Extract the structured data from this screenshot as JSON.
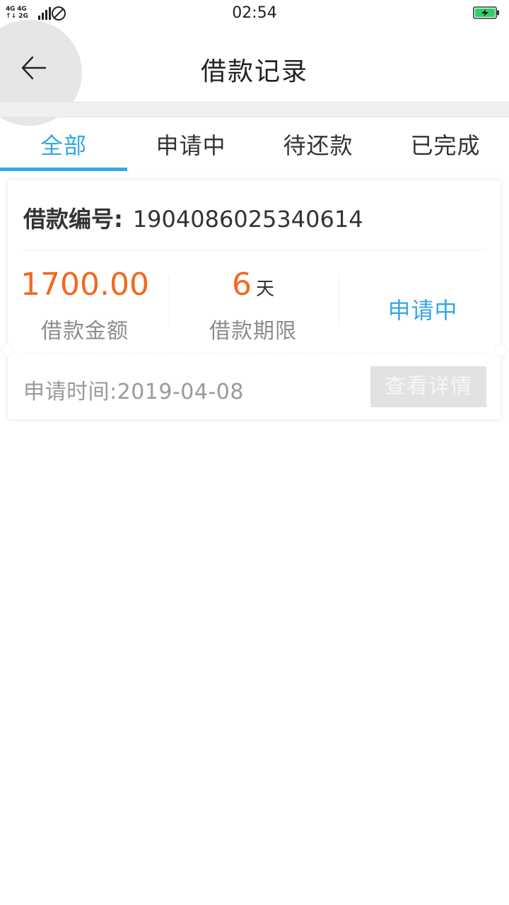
{
  "status_bar": {
    "network_top": "4G 4G",
    "network_bottom": "↑↓ 2G",
    "time": "02:54"
  },
  "header": {
    "title": "借款记录"
  },
  "tabs": [
    {
      "label": "全部",
      "active": true
    },
    {
      "label": "申请中",
      "active": false
    },
    {
      "label": "待还款",
      "active": false
    },
    {
      "label": "已完成",
      "active": false
    }
  ],
  "loan_card": {
    "number_label": "借款编号:",
    "number_value": "1904086025340614",
    "amount_value": "1700.00",
    "amount_label": "借款金额",
    "term_value": "6",
    "term_unit": "天",
    "term_label": "借款期限",
    "status": "申请中",
    "apply_time": "申请时间:2019-04-08",
    "detail_button": "查看详情"
  },
  "colors": {
    "accent_blue": "#33a8e5",
    "amount_orange": "#f06a1e",
    "battery_green": "#2fd06a"
  }
}
